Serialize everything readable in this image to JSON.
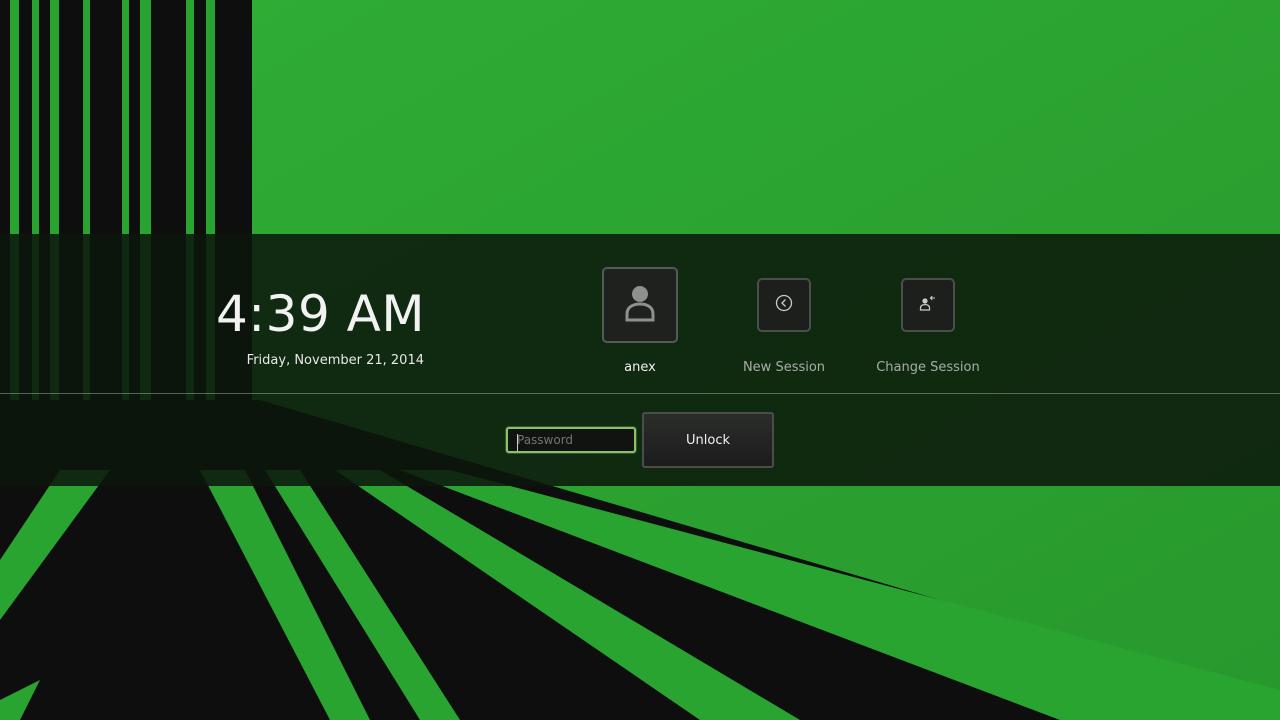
{
  "lock_screen": {
    "time": "4:39 AM",
    "date": "Friday, November 21, 2014"
  },
  "sessions": {
    "user": {
      "label": "anex",
      "icon": "user-avatar-icon"
    },
    "new_session": {
      "label": "New Session",
      "icon": "back-arrow-circle-icon"
    },
    "change_session": {
      "label": "Change Session",
      "icon": "switch-user-icon"
    }
  },
  "unlock_form": {
    "password_placeholder": "Password",
    "password_value": "",
    "unlock_label": "Unlock"
  },
  "colors": {
    "wallpaper_green": "#2a9e30",
    "wallpaper_dark": "#0e0e0e",
    "focus_ring": "#8cc06a"
  }
}
